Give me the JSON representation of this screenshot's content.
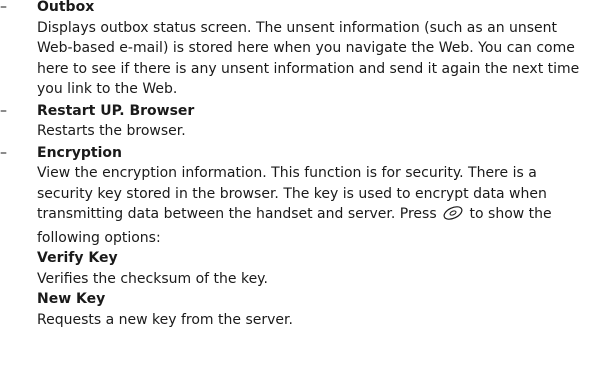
{
  "items": [
    {
      "bullet": "–",
      "term": "Outbox",
      "lines": [
        "Displays outbox status screen. The unsent information (such as an unsent",
        "Web-based e-mail) is stored here when you navigate the Web. You can come",
        "here to see if there is any unsent information and send it again the next time",
        "you link to the Web."
      ]
    },
    {
      "bullet": "–",
      "term": "Restart UP. Browser",
      "lines": [
        "Restarts the browser."
      ]
    },
    {
      "bullet": "–",
      "term": "Encryption",
      "lines": [
        "View the encryption information. This function is for security. There is a",
        "security key stored in the browser. The key is used to encrypt data when",
        "transmitting data between the handset and server. Press",
        "to show the",
        "following options:"
      ],
      "options": [
        {
          "term": "Verify Key",
          "desc": "Verifies the checksum of the key."
        },
        {
          "term": "New Key",
          "desc": "Requests a new key from the server."
        }
      ]
    }
  ],
  "icons": {
    "press_key": "navigation-key-icon"
  }
}
